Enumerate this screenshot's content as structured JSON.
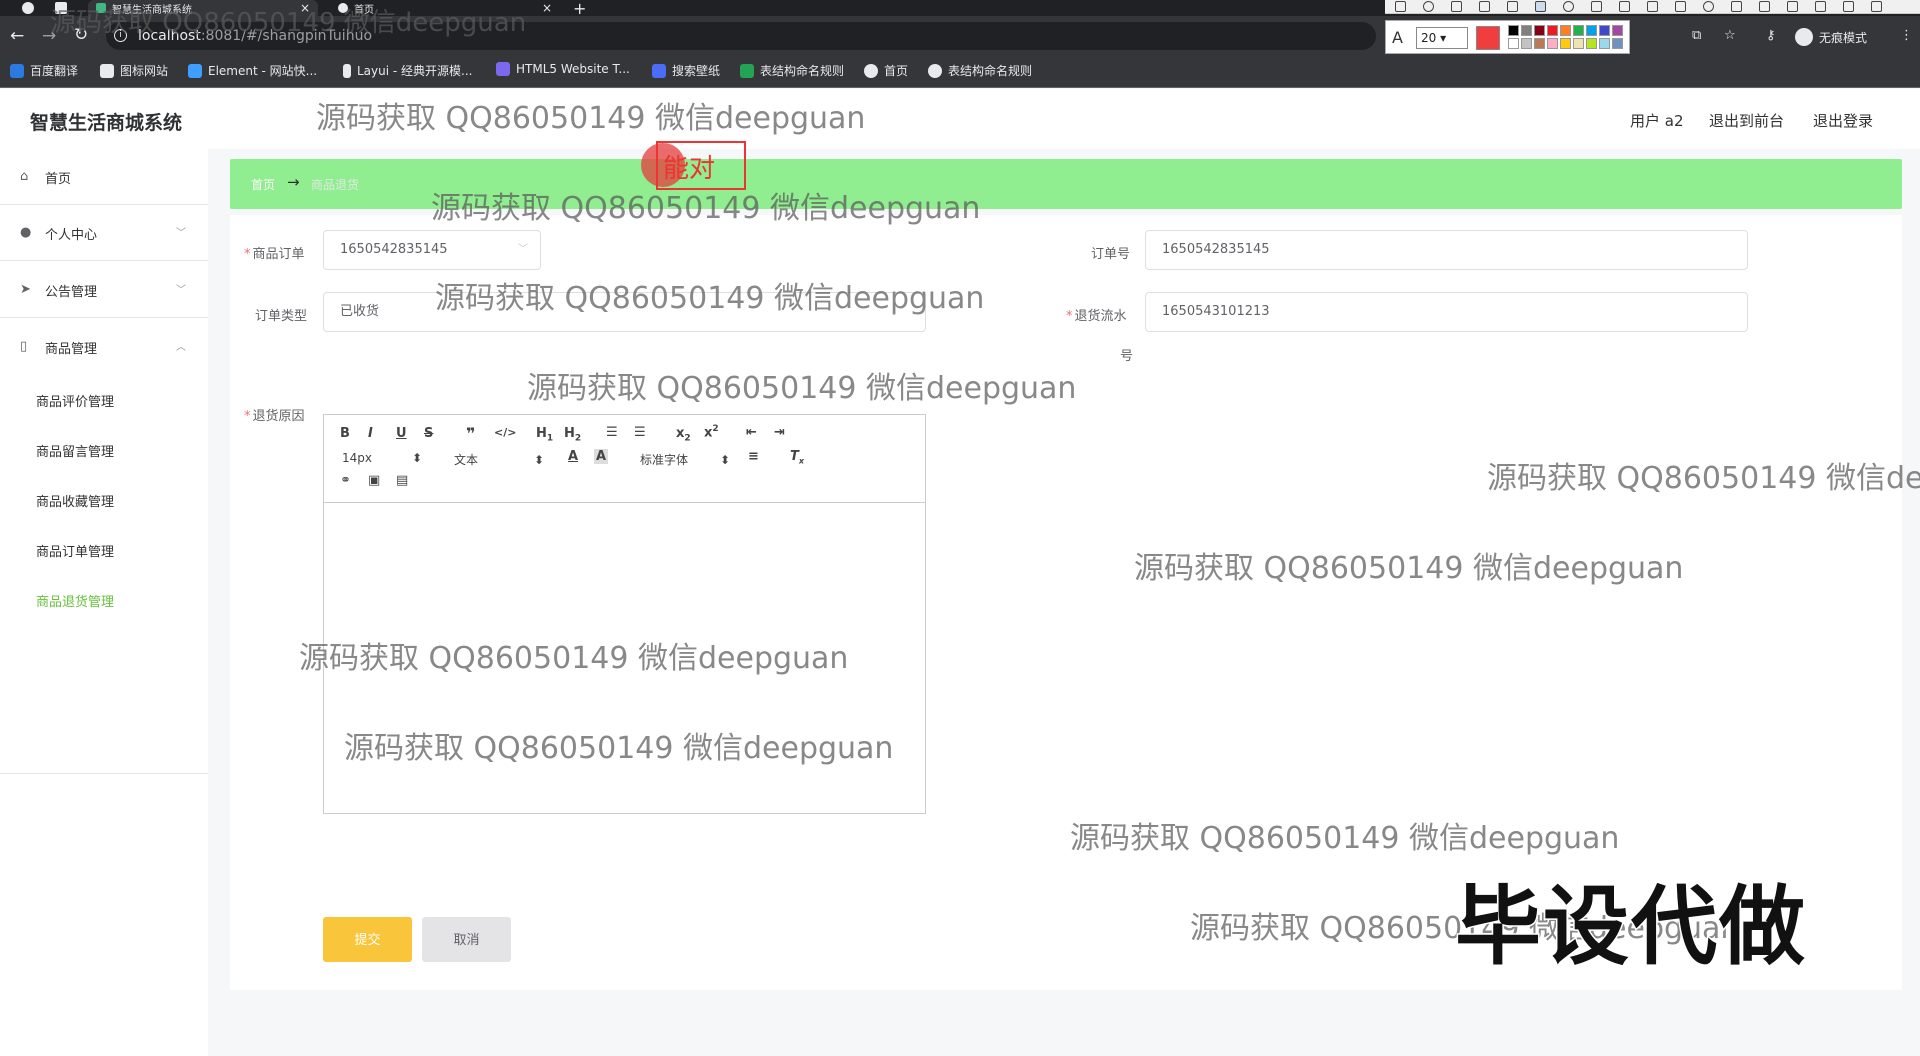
{
  "browser": {
    "tabs": [
      {
        "title": "智慧生活商城系统",
        "active": true
      },
      {
        "title": "首页",
        "active": false
      }
    ],
    "url_host": "localhost",
    "url_rest": ":8081/#/shangpinTuihuo",
    "profile_label": "无痕模式",
    "bookmarks": [
      "百度翻译",
      "图标网站",
      "Element - 网站快...",
      "Layui - 经典开源模...",
      "HTML5 Website T...",
      "搜索壁纸",
      "表结构命名规则",
      "首页",
      "表结构命名规则"
    ]
  },
  "annot_tool": {
    "font_size": "20",
    "current_color": "#f03e3e",
    "colors": [
      "#000000",
      "#7f7f7f",
      "#880015",
      "#ed1c24",
      "#ff7f27",
      "#22b14c",
      "#00a2e8",
      "#3f48cc",
      "#a349a4",
      "#ffffff",
      "#c3c3c3",
      "#b97a57",
      "#ffaec9",
      "#ffc90e",
      "#efe4b0",
      "#b5e61d",
      "#99d9ea",
      "#7092be"
    ]
  },
  "app": {
    "title": "智慧生活商城系统",
    "user_label": "用户 a2",
    "to_front": "退出到前台",
    "logout": "退出登录"
  },
  "sidebar": {
    "items": [
      {
        "label": "首页",
        "icon": "home-icon"
      },
      {
        "label": "个人中心",
        "icon": "user-icon"
      },
      {
        "label": "公告管理",
        "icon": "send-icon"
      },
      {
        "label": "商品管理",
        "icon": "phone-icon"
      }
    ],
    "sub_items": [
      "商品评价管理",
      "商品留言管理",
      "商品收藏管理",
      "商品订单管理",
      "商品退货管理"
    ]
  },
  "breadcrumb": {
    "home": "首页",
    "separator": "→",
    "current": "商品退货"
  },
  "form": {
    "order_label": "商品订单",
    "order_value": "1650542835145",
    "order_no_label": "订单号",
    "order_no_value": "1650542835145",
    "order_type_label": "订单类型",
    "order_type_value": "已收货",
    "serial_label_1": "退货流水",
    "serial_label_2": "号",
    "serial_value": "1650543101213",
    "reason_label": "退货原因",
    "submit": "提交",
    "cancel": "取消"
  },
  "editor": {
    "font_size": "14px",
    "paragraph": "文本",
    "font_family": "标准字体"
  },
  "overlay": {
    "watermark": "源码获取 QQ86050149 微信deepguan",
    "watermark_cut": "源码获取 QQ86050149 微信de",
    "stamp": "毕设代做",
    "note": "能对"
  }
}
